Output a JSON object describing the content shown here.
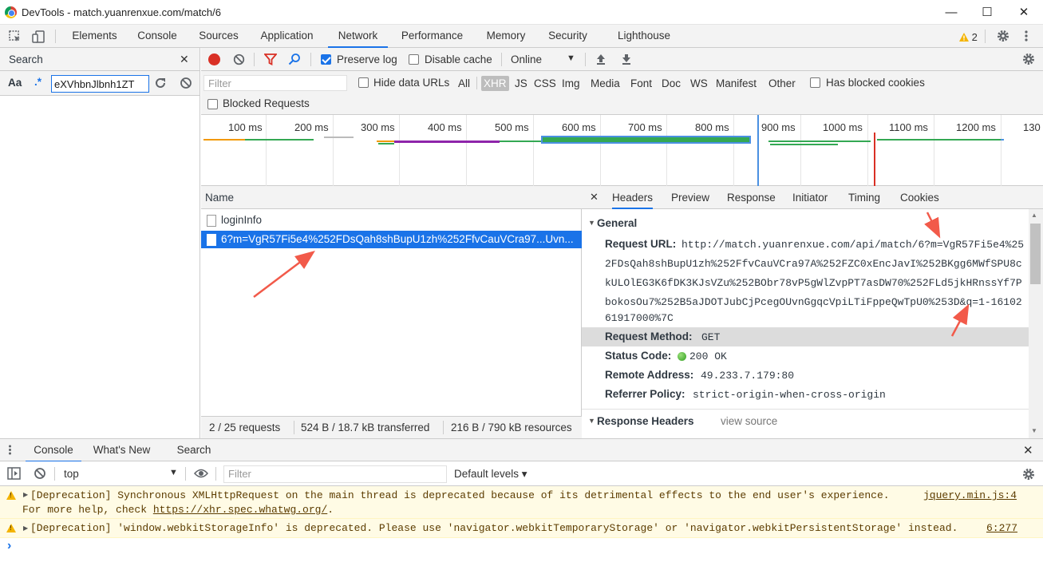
{
  "window": {
    "title": "DevTools - match.yuanrenxue.com/match/6",
    "minimize": "—",
    "maximize": "☐",
    "close": "✕"
  },
  "main_tabs": [
    "Elements",
    "Console",
    "Sources",
    "Application",
    "Network",
    "Performance",
    "Memory",
    "Security",
    "Lighthouse"
  ],
  "active_main_tab": "Network",
  "warning_badge": "2",
  "search_panel": {
    "title": "Search",
    "close": "✕",
    "case_btn": "Aa",
    "regex_btn": ".*",
    "query": "eXVhbnJlbnh1ZT"
  },
  "network_toolbar": {
    "preserve_log": "Preserve log",
    "disable_cache": "Disable cache",
    "throttle": "Online"
  },
  "filter_bar": {
    "filter_placeholder": "Filter",
    "hide_data_urls": "Hide data URLs",
    "types": [
      "All",
      "XHR",
      "JS",
      "CSS",
      "Img",
      "Media",
      "Font",
      "Doc",
      "WS",
      "Manifest",
      "Other"
    ],
    "active_type": "XHR",
    "has_blocked_cookies": "Has blocked cookies",
    "blocked_requests": "Blocked Requests"
  },
  "overview": {
    "ticks": [
      "100 ms",
      "200 ms",
      "300 ms",
      "400 ms",
      "500 ms",
      "600 ms",
      "700 ms",
      "800 ms",
      "900 ms",
      "1000 ms",
      "1100 ms",
      "1200 ms",
      "130"
    ]
  },
  "request_list": {
    "header": "Name",
    "rows": [
      {
        "name": "loginInfo",
        "selected": false
      },
      {
        "name": "6?m=VgR57Fi5e4%252FDsQah8shBupU1zh%252FfvCauVCra97...Uvn...",
        "selected": true
      }
    ],
    "status": {
      "requests": "2 / 25 requests",
      "transferred": "524 B / 18.7 kB transferred",
      "resources": "216 B / 790 kB resources"
    }
  },
  "headers_pane": {
    "close": "✕",
    "tabs": [
      "Headers",
      "Preview",
      "Response",
      "Initiator",
      "Timing",
      "Cookies"
    ],
    "active_tab": "Headers",
    "general_title": "General",
    "request_url_key": "Request URL:",
    "request_url_lines": [
      "http://match.yuanrenxue.com/api/match/6?m=VgR57Fi5e4%25",
      "2FDsQah8shBupU1zh%252FfvCauVCra97A%252FZC0xEncJavI%252BKgg6MWfSPU8c",
      "kULOlEG3K6fDK3KJsVZu%252BObr78vP5gWlZvpPT7asDW70%252FLd5jkHRnssYf7P",
      "bokosOu7%252B5aJDOTJubCjPcegOUvnGgqcVpiLTiFppeQwTpU0%253D&q=1-16102",
      "61917000%7C"
    ],
    "request_method_key": "Request Method:",
    "request_method_val": "GET",
    "status_code_key": "Status Code:",
    "status_code_val": "200 OK",
    "remote_address_key": "Remote Address:",
    "remote_address_val": "49.233.7.179:80",
    "referrer_policy_key": "Referrer Policy:",
    "referrer_policy_val": "strict-origin-when-cross-origin",
    "response_headers_title": "Response Headers",
    "view_source": "view source"
  },
  "drawer": {
    "tabs": [
      "Console",
      "What's New",
      "Search"
    ],
    "active_tab": "Console",
    "close": "✕",
    "context": "top",
    "filter_placeholder": "Filter",
    "levels": "Default levels ▾"
  },
  "console_messages": [
    {
      "text_line1": "[Deprecation] Synchronous XMLHttpRequest on the main thread is deprecated because of its detrimental effects to the end user's experience.",
      "text_line2_prefix": "For more help, check ",
      "text_line2_link": "https://xhr.spec.whatwg.org/",
      "text_line2_suffix": ".",
      "source": "jquery.min.js:4"
    },
    {
      "text_line1": "[Deprecation] 'window.webkitStorageInfo' is deprecated. Please use 'navigator.webkitTemporaryStorage' or 'navigator.webkitPersistentStorage' instead.",
      "source": "6:277"
    }
  ],
  "console_prompt": "›"
}
